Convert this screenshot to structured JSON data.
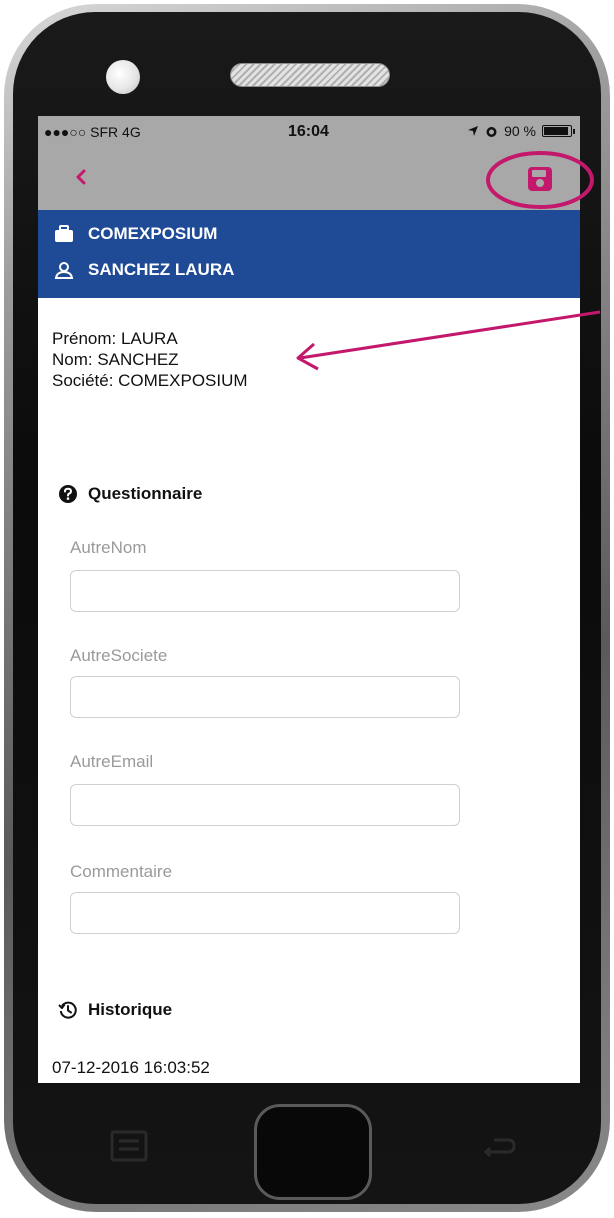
{
  "status_bar": {
    "carrier": "●●●○○ SFR   4G",
    "time": "16:04",
    "battery": "90 %"
  },
  "nav": {
    "back_icon": "chevron-left-icon",
    "save_icon": "save-icon"
  },
  "banner": {
    "company": "COMEXPOSIUM",
    "contact": "SANCHEZ LAURA"
  },
  "info": {
    "first_name": "Prénom: LAURA",
    "last_name": "Nom: SANCHEZ",
    "company": "Société: COMEXPOSIUM"
  },
  "questionnaire": {
    "title": "Questionnaire",
    "fields": [
      {
        "label": "AutreNom",
        "value": ""
      },
      {
        "label": "AutreSociete",
        "value": ""
      },
      {
        "label": "AutreEmail",
        "value": ""
      },
      {
        "label": "Commentaire",
        "value": ""
      }
    ]
  },
  "history": {
    "title": "Historique",
    "entries": [
      "07-12-2016 16:03:52"
    ]
  },
  "colors": {
    "accent": "#c4186c",
    "banner": "#1f4a96",
    "navbar": "#a8a8a8"
  }
}
